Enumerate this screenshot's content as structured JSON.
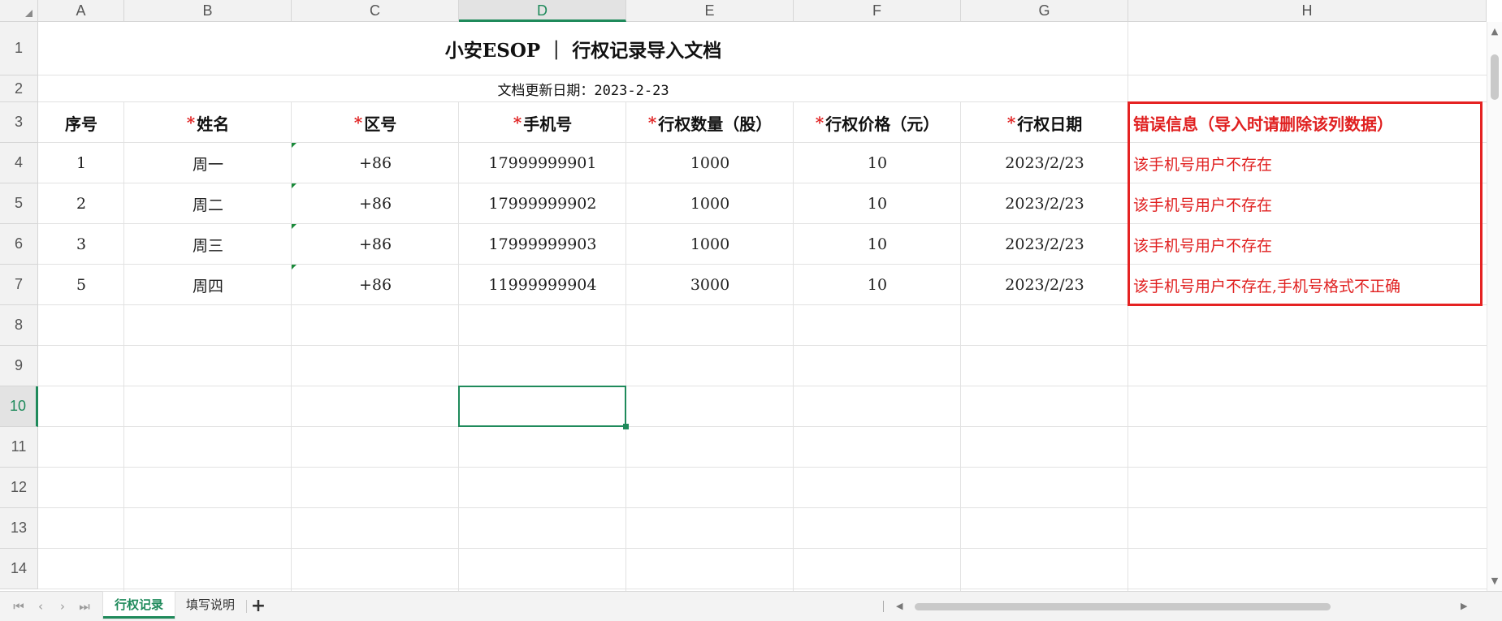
{
  "columns": [
    "A",
    "B",
    "C",
    "D",
    "E",
    "F",
    "G",
    "H"
  ],
  "active_column": "D",
  "rows": [
    "1",
    "2",
    "3",
    "4",
    "5",
    "6",
    "7",
    "8",
    "9",
    "10",
    "11",
    "12",
    "13",
    "14"
  ],
  "active_row": "10",
  "sheet": {
    "title": "小安ESOP ｜ 行权记录导入文档",
    "subtitle": "文档更新日期：2023-2-23",
    "required_marker": "*",
    "headers": {
      "index": "序号",
      "name": "姓名",
      "area_code": "区号",
      "phone": "手机号",
      "quantity": "行权数量（股）",
      "price": "行权价格（元）",
      "date": "行权日期",
      "error": "错误信息（导入时请删除该列数据）"
    },
    "records": [
      {
        "index": "1",
        "name": "周一",
        "area_code": "+86",
        "phone": "17999999901",
        "quantity": "1000",
        "price": "10",
        "date": "2023/2/23",
        "error": "该手机号用户不存在"
      },
      {
        "index": "2",
        "name": "周二",
        "area_code": "+86",
        "phone": "17999999902",
        "quantity": "1000",
        "price": "10",
        "date": "2023/2/23",
        "error": "该手机号用户不存在"
      },
      {
        "index": "3",
        "name": "周三",
        "area_code": "+86",
        "phone": "17999999903",
        "quantity": "1000",
        "price": "10",
        "date": "2023/2/23",
        "error": "该手机号用户不存在"
      },
      {
        "index": "5",
        "name": "周四",
        "area_code": "+86",
        "phone": "11999999904",
        "quantity": "3000",
        "price": "10",
        "date": "2023/2/23",
        "error": "该手机号用户不存在,手机号格式不正确"
      }
    ]
  },
  "tabs": {
    "first_icon": "⏮",
    "prev_icon": "‹",
    "next_icon": "›",
    "last_icon": "⏭",
    "items": [
      {
        "label": "行权记录",
        "active": true
      },
      {
        "label": "填写说明",
        "active": false
      }
    ],
    "add_label": "+"
  },
  "colors": {
    "accent": "#1f8a5b",
    "error": "#e02020",
    "error_border": "#e52222",
    "grid": "#e2e2e2",
    "header_bg": "#f2f2f2"
  }
}
